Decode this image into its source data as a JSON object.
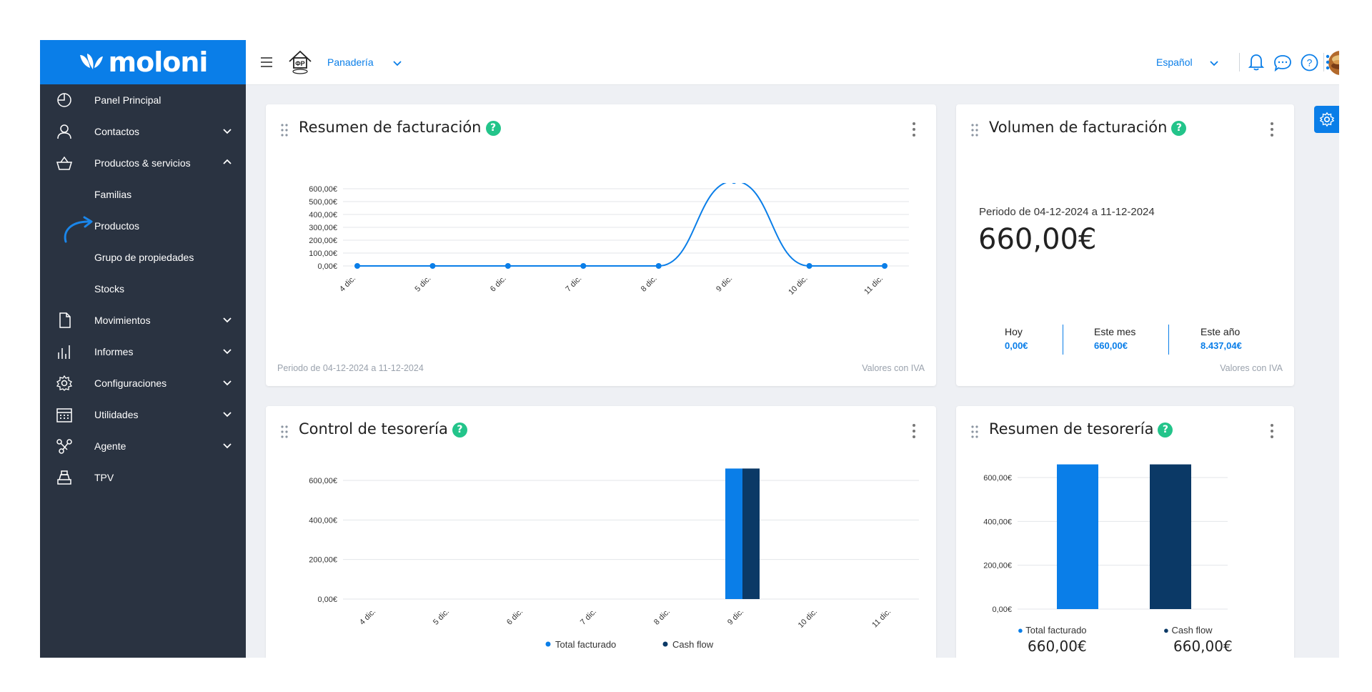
{
  "brand": {
    "name": "moloni",
    "color": "#0a7ee8"
  },
  "sidebar": {
    "items": [
      {
        "label": "Panel Principal",
        "icon": "pie-chart-icon",
        "chevron": ""
      },
      {
        "label": "Contactos",
        "icon": "person-icon",
        "chevron": "down"
      },
      {
        "label": "Productos & servicios",
        "icon": "basket-icon",
        "chevron": "up"
      },
      {
        "label": "Familias",
        "sub": true
      },
      {
        "label": "Productos",
        "sub": true,
        "highlight": true
      },
      {
        "label": "Grupo de propiedades",
        "sub": true
      },
      {
        "label": "Stocks",
        "sub": true
      },
      {
        "label": "Movimientos",
        "icon": "document-icon",
        "chevron": "down"
      },
      {
        "label": "Informes",
        "icon": "bar-chart-icon",
        "chevron": "down"
      },
      {
        "label": "Configuraciones",
        "icon": "gear-icon",
        "chevron": "down"
      },
      {
        "label": "Utilidades",
        "icon": "calendar-icon",
        "chevron": "down"
      },
      {
        "label": "Agente",
        "icon": "share-icon",
        "chevron": "down"
      },
      {
        "label": "TPV",
        "icon": "cash-register-icon",
        "chevron": ""
      }
    ]
  },
  "topbar": {
    "company": "Panadería",
    "language": "Español"
  },
  "cards": {
    "resumen_facturacion": {
      "title": "Resumen de facturación",
      "footer_left": "Periodo de 04-12-2024 a 11-12-2024",
      "footer_right": "Valores con IVA"
    },
    "volumen_facturacion": {
      "title": "Volumen de facturación",
      "period": "Periodo de 04-12-2024 a 11-12-2024",
      "total": "660,00€",
      "stats": [
        {
          "label": "Hoy",
          "value": "0,00€"
        },
        {
          "label": "Este mes",
          "value": "660,00€"
        },
        {
          "label": "Este año",
          "value": "8.437,04€"
        }
      ],
      "footer_right": "Valores con IVA"
    },
    "control_tesoreria": {
      "title": "Control de tesorería"
    },
    "resumen_tesoreria": {
      "title": "Resumen de tesorería",
      "totals": [
        {
          "label": "Total facturado",
          "value": "660,00€"
        },
        {
          "label": "Cash flow",
          "value": "660,00€"
        }
      ]
    }
  },
  "colors": {
    "light_blue": "#0a7ee8",
    "dark_blue": "#0b3966",
    "green": "#23c48a",
    "sidebar": "#2a3341"
  },
  "chart_data": [
    {
      "type": "line",
      "categories": [
        "4 dic.",
        "5 dic.",
        "6 dic.",
        "7 dic.",
        "8 dic.",
        "9 dic.",
        "10 dic.",
        "11 dic."
      ],
      "values": [
        0,
        0,
        0,
        0,
        0,
        660,
        0,
        0
      ],
      "yticks": [
        "0,00€",
        "100,00€",
        "200,00€",
        "300,00€",
        "400,00€",
        "500,00€",
        "600,00€"
      ],
      "ylim": [
        0,
        600
      ],
      "grid": true
    },
    {
      "type": "bar",
      "categories": [
        "4 dic.",
        "5 dic.",
        "6 dic.",
        "7 dic.",
        "8 dic.",
        "9 dic.",
        "10 dic.",
        "11 dic."
      ],
      "series": [
        {
          "name": "Total facturado",
          "values": [
            0,
            0,
            0,
            0,
            0,
            660,
            0,
            0
          ]
        },
        {
          "name": "Cash flow",
          "values": [
            0,
            0,
            0,
            0,
            0,
            660,
            0,
            0
          ]
        }
      ],
      "yticks": [
        "0,00€",
        "200,00€",
        "400,00€",
        "600,00€"
      ],
      "ylim": [
        0,
        600
      ],
      "legend": "bottom",
      "grid": true
    },
    {
      "type": "bar",
      "categories": [
        "Total facturado",
        "Cash flow"
      ],
      "values": [
        660,
        660
      ],
      "yticks": [
        "0,00€",
        "200,00€",
        "400,00€",
        "600,00€"
      ],
      "ylim": [
        0,
        600
      ],
      "legend": "bottom",
      "grid": true
    }
  ]
}
